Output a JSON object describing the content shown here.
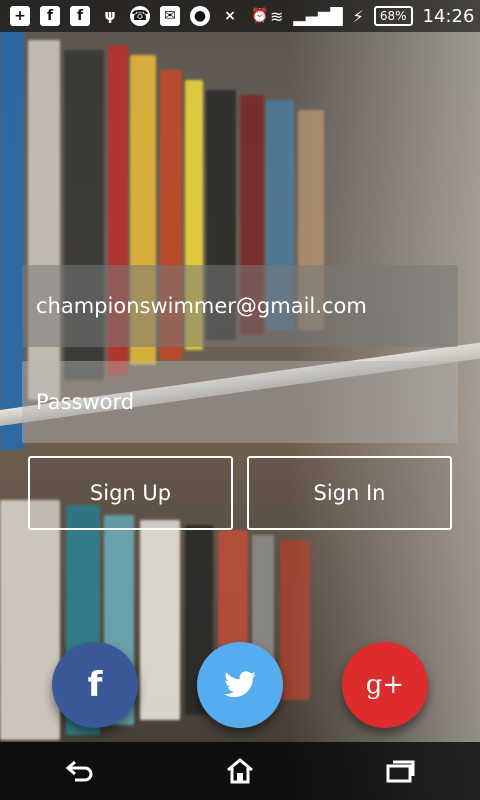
{
  "status": {
    "battery_percent": "68%",
    "time": "14:26",
    "icons": [
      "plus-square-icon",
      "facebook-icon",
      "facebook-icon",
      "usb-icon",
      "whatsapp-icon",
      "mail-icon",
      "chrome-icon",
      "network-icon",
      "alarm-icon",
      "wifi-icon",
      "signal-icon",
      "charging-icon"
    ]
  },
  "form": {
    "email_value": "championswimmer@gmail.com",
    "password_placeholder": "Password"
  },
  "buttons": {
    "signup": "Sign Up",
    "signin": "Sign In"
  },
  "social": {
    "facebook_label": "f",
    "googleplus_label": "g+"
  },
  "colors": {
    "facebook": "#3b5998",
    "twitter": "#55acee",
    "googleplus": "#de2c2c"
  },
  "nav": {
    "icons": [
      "back-icon",
      "home-icon",
      "recent-apps-icon"
    ]
  }
}
